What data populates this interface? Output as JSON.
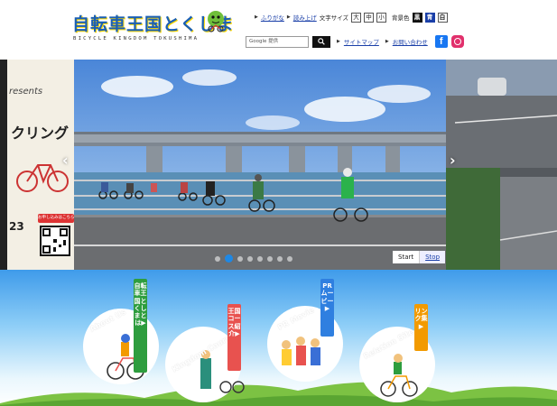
{
  "site": {
    "logo_title": "自転車王国とくしま",
    "logo_subtitle": "BICYCLE KINGDOM TOKUSHIMA"
  },
  "utility": {
    "furigana": "ふりがな",
    "yomiage": "読み上げ",
    "font_size_label": "文字サイズ",
    "font_sizes": [
      "大",
      "中",
      "小"
    ],
    "bg_color_label": "背景色",
    "bg_colors": [
      {
        "label": "黒",
        "bg": "#111111",
        "fg": "#ffffff"
      },
      {
        "label": "青",
        "bg": "#1a3fa8",
        "fg": "#ffffff"
      },
      {
        "label": "白",
        "bg": "#ffffff",
        "fg": "#111111"
      }
    ],
    "search_placeholder": "Google 提供",
    "sitemap": "サイトマップ",
    "contact": "お問い合わせ"
  },
  "carousel": {
    "left_slide": {
      "text_presents": "resents",
      "text_cycling": "クリング",
      "text_num": "23",
      "badge": "お申し込みはこちら"
    },
    "prev_arrow": "‹",
    "next_arrow": "›",
    "dot_count": 8,
    "active_dot": 1,
    "start_label": "Start",
    "stop_label": "Stop"
  },
  "banners": {
    "about": {
      "arc": "About Us",
      "tag": "自転車王国とくしまとは▶",
      "color": "#2e9d3e"
    },
    "courses": {
      "arc": "Kingdom Courses",
      "tag": "王国コース紹介▶",
      "color": "#e8524f"
    },
    "pr": {
      "arc": "PR Movie",
      "tag": "PRムービー▶",
      "color": "#2f7fe0"
    },
    "relation": {
      "arc": "Relation Site",
      "tag": "リンク集▶",
      "color": "#f29a00"
    }
  }
}
